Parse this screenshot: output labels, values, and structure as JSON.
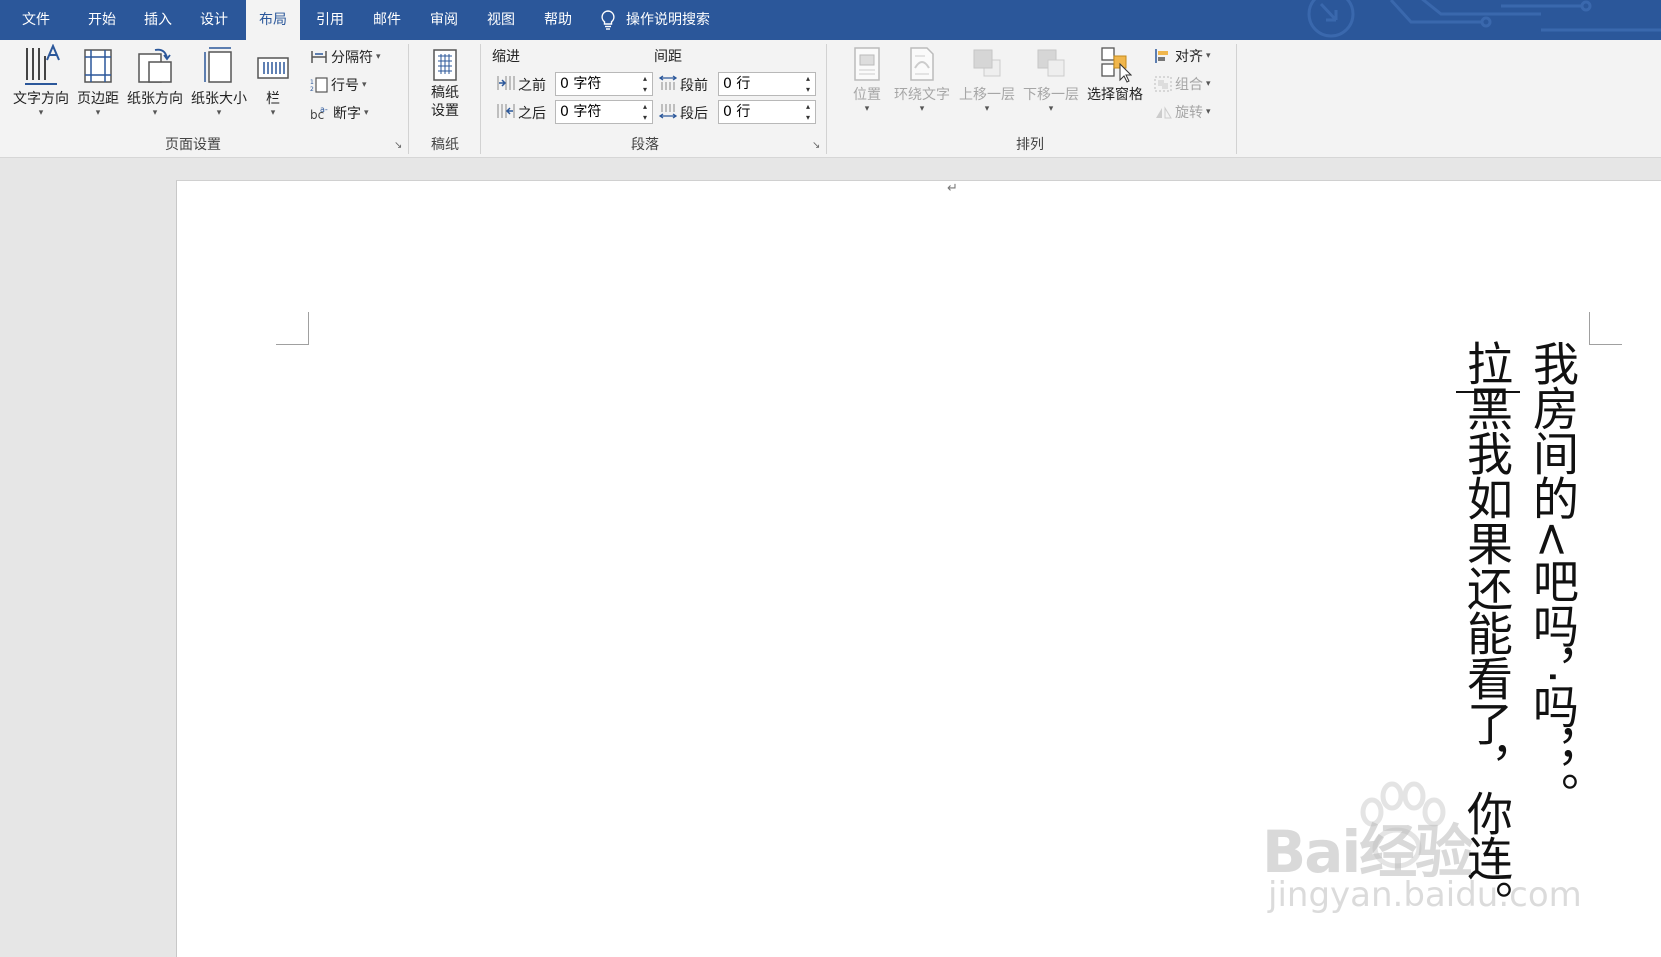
{
  "menu": {
    "tabs": [
      "文件",
      "开始",
      "插入",
      "设计",
      "布局",
      "引用",
      "邮件",
      "审阅",
      "视图",
      "帮助"
    ],
    "active_tab": "布局",
    "search_label": "操作说明搜索"
  },
  "ribbon": {
    "page_setup": {
      "label": "页面设置",
      "text_direction": "文字方向",
      "margins": "页边距",
      "orientation": "纸张方向",
      "size": "纸张大小",
      "columns": "栏",
      "breaks": "分隔符",
      "line_numbers": "行号",
      "hyphenation": "断字"
    },
    "manuscript": {
      "label": "稿纸",
      "settings_line1": "稿纸",
      "settings_line2": "设置"
    },
    "paragraph": {
      "label": "段落",
      "indent_header": "缩进",
      "spacing_header": "间距",
      "indent_before_label": "之前",
      "indent_before_value": "0 字符",
      "indent_after_label": "之后",
      "indent_after_value": "0 字符",
      "spacing_before_label": "段前",
      "spacing_before_value": "0 行",
      "spacing_after_label": "段后",
      "spacing_after_value": "0 行"
    },
    "arrange": {
      "label": "排列",
      "position": "位置",
      "wrap_text": "环绕文字",
      "bring_forward": "上移一层",
      "send_backward": "下移一层",
      "selection_pane": "选择窗格",
      "align": "对齐",
      "group": "组合",
      "rotate": "旋转"
    }
  },
  "document": {
    "paragraph_mark": "↵",
    "column_right": "我房间的<吧吗，·吗，，。",
    "column_left": "拉黑我如果还能看了，你连。"
  },
  "watermark": {
    "brand": "Bai经验",
    "url": "jingyan.baidu.com"
  },
  "colors": {
    "accent": "#2b579a",
    "ribbon_bg": "#f3f3f3",
    "workspace_bg": "#e6e6e6"
  }
}
